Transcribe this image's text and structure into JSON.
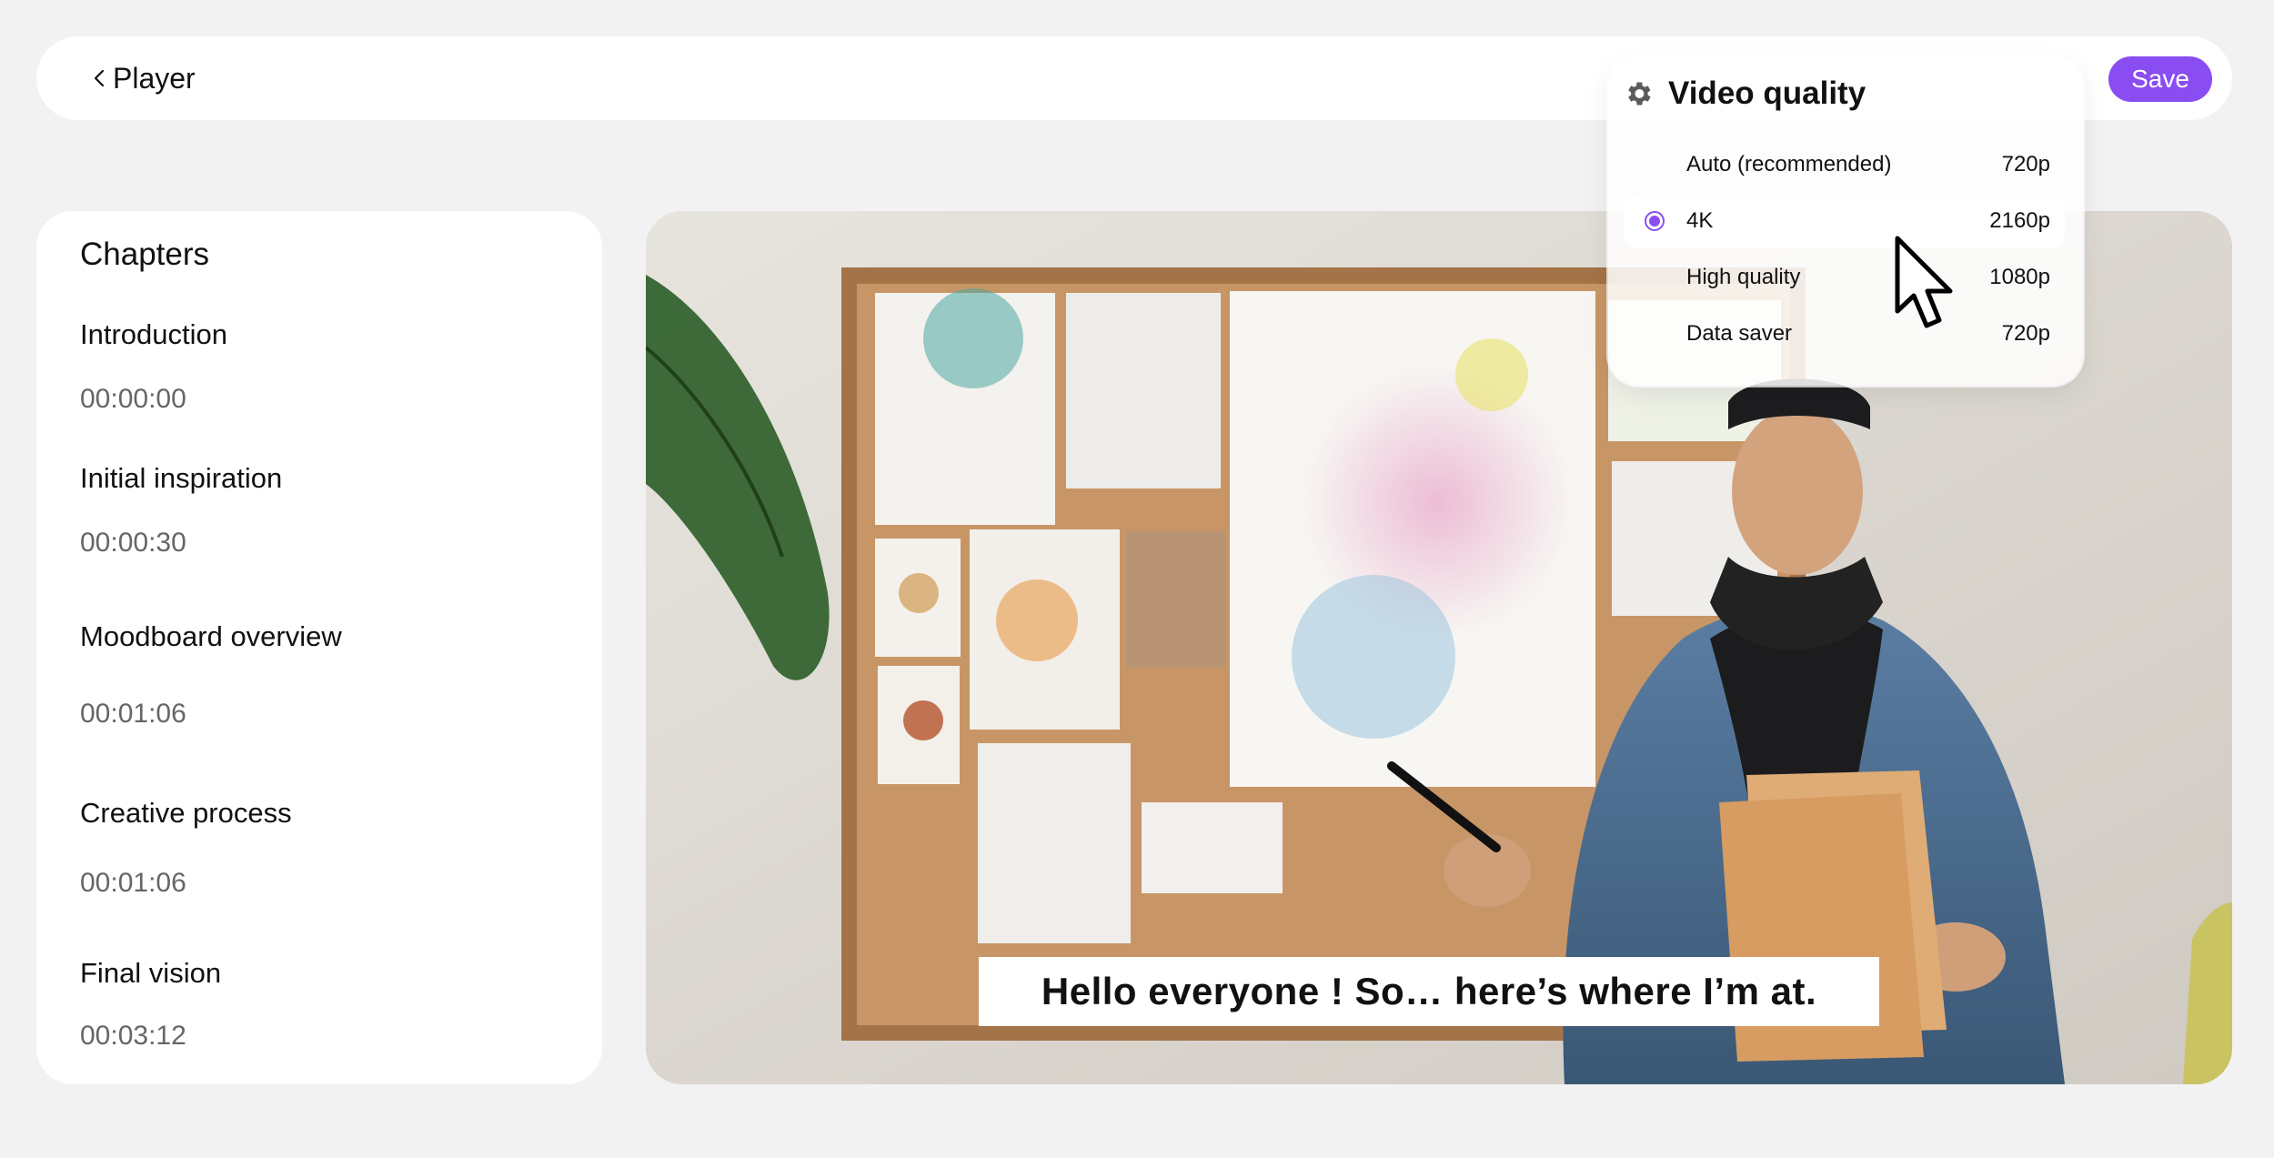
{
  "header": {
    "title": "Player",
    "save_label": "Save"
  },
  "chapters": {
    "title": "Chapters",
    "items": [
      {
        "name": "Introduction",
        "time": "00:00:00"
      },
      {
        "name": "Initial inspiration",
        "time": "00:00:30"
      },
      {
        "name": "Moodboard overview",
        "time": "00:01:06"
      },
      {
        "name": "Creative process",
        "time": "00:01:06"
      },
      {
        "name": "Final vision",
        "time": "00:03:12"
      }
    ]
  },
  "video": {
    "caption": "Hello everyone ! So… here’s where I’m at."
  },
  "quality": {
    "title": "Video quality",
    "options": [
      {
        "label": "Auto (recommended)",
        "resolution": "720p",
        "selected": false
      },
      {
        "label": "4K",
        "resolution": "2160p",
        "selected": true
      },
      {
        "label": "High quality",
        "resolution": "1080p",
        "selected": false
      },
      {
        "label": "Data saver",
        "resolution": "720p",
        "selected": false
      }
    ]
  },
  "colors": {
    "accent": "#8a4df2",
    "background": "#f2f2f2",
    "panel": "#ffffff"
  },
  "icons": {
    "back": "chevron-left-icon",
    "settings": "gear-icon",
    "pointer": "mouse-pointer-icon"
  }
}
